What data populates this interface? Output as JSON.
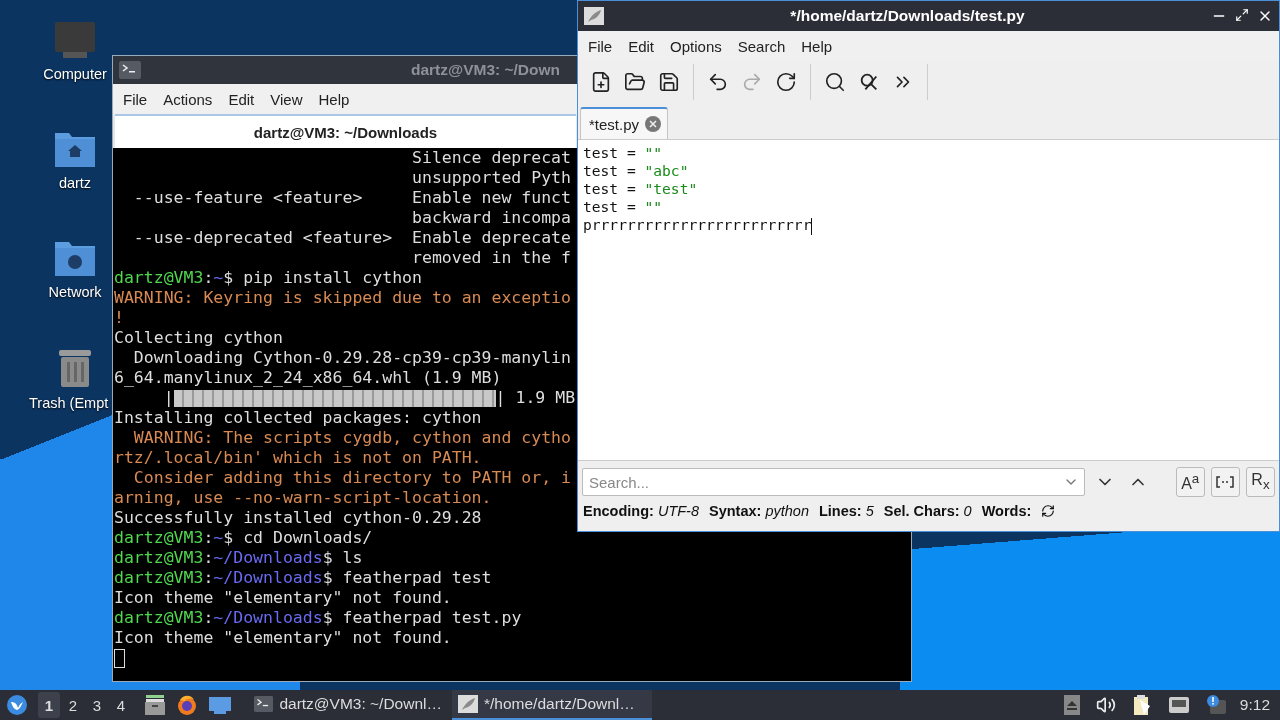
{
  "desktop_icons": [
    {
      "kind": "computer",
      "label": "Computer"
    },
    {
      "kind": "home",
      "label": "dartz"
    },
    {
      "kind": "network",
      "label": "Network"
    },
    {
      "kind": "trash",
      "label": "Trash (Empt"
    }
  ],
  "terminal": {
    "title": "dartz@VM3: ~/Down",
    "menu": [
      "File",
      "Actions",
      "Edit",
      "View",
      "Help"
    ],
    "tab_title": "dartz@VM3: ~/Downloads",
    "lines": [
      {
        "kind": "output",
        "text": "                              Silence deprecat"
      },
      {
        "kind": "output",
        "text": "                              unsupported Pyth"
      },
      {
        "kind": "output",
        "text": "  --use-feature <feature>     Enable new funct"
      },
      {
        "kind": "output",
        "text": "                              backward incompa"
      },
      {
        "kind": "output",
        "text": "  --use-deprecated <feature>  Enable deprecate"
      },
      {
        "kind": "output",
        "text": "                              removed in the f"
      },
      {
        "kind": "prompt",
        "user": "dartz@VM3",
        "sep": ":",
        "path": "~",
        "dollar": "$",
        "command": "pip install cython"
      },
      {
        "kind": "warning",
        "text": "WARNING: Keyring is skipped due to an exceptio"
      },
      {
        "kind": "warning",
        "text": "!"
      },
      {
        "kind": "output",
        "text": "Collecting cython"
      },
      {
        "kind": "output",
        "text": "  Downloading Cython-0.29.28-cp39-cp39-manylin"
      },
      {
        "kind": "output",
        "text": "6_64.manylinux_2_24_x86_64.whl (1.9 MB)"
      },
      {
        "kind": "progress",
        "open": "     |",
        "level": 1,
        "close": "| 1.9 MB"
      },
      {
        "kind": "output",
        "text": "Installing collected packages: cython"
      },
      {
        "kind": "warning",
        "text": "  WARNING: The scripts cygdb, cython and cytho"
      },
      {
        "kind": "warning",
        "text": "rtz/.local/bin' which is not on PATH."
      },
      {
        "kind": "warning",
        "text": "  Consider adding this directory to PATH or, i"
      },
      {
        "kind": "warning",
        "text": "arning, use --no-warn-script-location."
      },
      {
        "kind": "output",
        "text": "Successfully installed cython-0.29.28"
      },
      {
        "kind": "prompt",
        "user": "dartz@VM3",
        "sep": ":",
        "path": "~",
        "dollar": "$",
        "command": "cd Downloads/"
      },
      {
        "kind": "prompt",
        "user": "dartz@VM3",
        "sep": ":",
        "path": "~/Downloads",
        "dollar": "$",
        "command": "ls"
      },
      {
        "kind": "prompt",
        "user": "dartz@VM3",
        "sep": ":",
        "path": "~/Downloads",
        "dollar": "$",
        "command": "featherpad test"
      },
      {
        "kind": "output",
        "text": "Icon theme \"elementary\" not found."
      },
      {
        "kind": "prompt",
        "user": "dartz@VM3",
        "sep": ":",
        "path": "~/Downloads",
        "dollar": "$",
        "command": "featherpad test.py"
      },
      {
        "kind": "output",
        "text": "Icon theme \"elementary\" not found."
      },
      {
        "kind": "cursor"
      }
    ]
  },
  "editor": {
    "title": "*/home/dartz/Downloads/test.py",
    "menu": [
      "File",
      "Edit",
      "Options",
      "Search",
      "Help"
    ],
    "toolbar": [
      {
        "kind": "new",
        "disabled": false
      },
      {
        "kind": "open",
        "disabled": false
      },
      {
        "kind": "save",
        "disabled": false
      },
      {
        "kind": "separator"
      },
      {
        "kind": "undo",
        "disabled": false
      },
      {
        "kind": "redo",
        "disabled": true
      },
      {
        "kind": "reload",
        "disabled": false
      },
      {
        "kind": "separator"
      },
      {
        "kind": "find",
        "disabled": false
      },
      {
        "kind": "replace",
        "disabled": false
      },
      {
        "kind": "more",
        "disabled": false
      },
      {
        "kind": "separator"
      }
    ],
    "tabs": [
      {
        "label": "*test.py",
        "selected": true
      }
    ],
    "code": [
      {
        "code": "test = ",
        "string": "\"\""
      },
      {
        "code": "test = ",
        "string": "\"abc\""
      },
      {
        "code": "test = ",
        "string": "\"test\""
      },
      {
        "code": "test = ",
        "string": "\"\""
      },
      {
        "code": "prrrrrrrrrrrrrrrrrrrrrrrrr",
        "cursor": true
      }
    ],
    "search": {
      "placeholder": "Search...",
      "toggles": [
        {
          "kind": "case",
          "label": "A$^{a}$"
        },
        {
          "kind": "word"
        },
        {
          "kind": "regex",
          "label": "R$_{x}$"
        }
      ]
    },
    "status": [
      {
        "label": "Encoding:",
        "value": "UTF-8"
      },
      {
        "label": "Syntax:",
        "value": "python"
      },
      {
        "label": "Lines:",
        "value": "5"
      },
      {
        "label": "Sel. Chars:",
        "value": "0"
      },
      {
        "label": "Words:"
      }
    ]
  },
  "taskbar": {
    "workspaces": [
      {
        "label": "1",
        "selected": true
      },
      {
        "label": "2",
        "selected": false
      },
      {
        "label": "3",
        "selected": false
      },
      {
        "label": "4",
        "selected": false
      }
    ],
    "tasks": [
      {
        "kind": "terminal",
        "label": "dartz@VM3: ~/Downl…",
        "selected": false
      },
      {
        "kind": "editor",
        "label": "*/home/dartz/Downl…",
        "selected": true
      }
    ],
    "clock": "9:12"
  }
}
